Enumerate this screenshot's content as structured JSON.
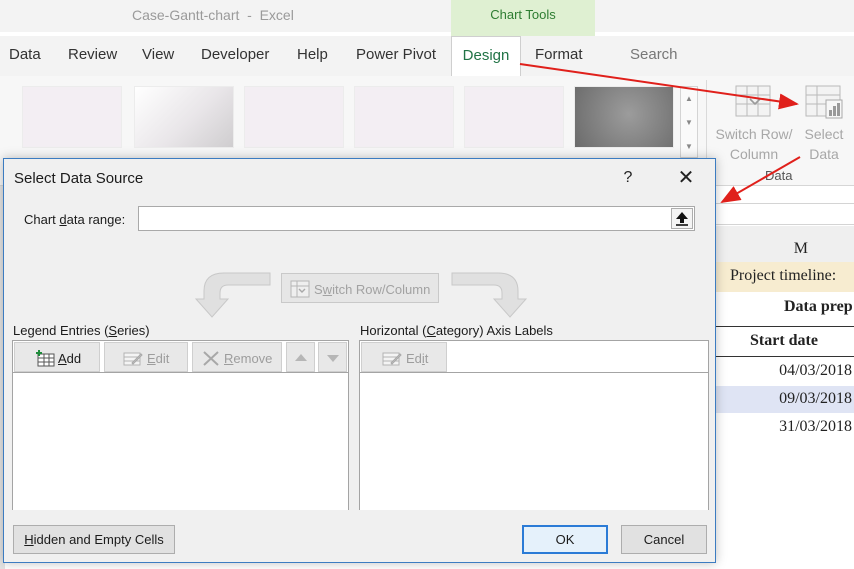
{
  "excel": {
    "doc_title": "Case-Gantt-chart  -  Excel",
    "context_tab_group": "Chart Tools",
    "tabs": [
      "Data",
      "Review",
      "View",
      "Developer",
      "Help",
      "Power Pivot",
      "Design",
      "Format"
    ],
    "search_label": "Search",
    "ribbon": {
      "switch_row_column": [
        "Switch Row/",
        "Column"
      ],
      "select_data": [
        "Select",
        "Data"
      ],
      "group_label": "Data"
    },
    "sheet": {
      "column_header": "M",
      "project_timeline": "Project timeline:",
      "data_prep": "Data prep",
      "start_date_header": "Start date",
      "dates": [
        "04/03/2018",
        "09/03/2018",
        "31/03/2018"
      ]
    }
  },
  "dialog": {
    "title": "Select Data Source",
    "help": "?",
    "close": "✕",
    "chart_range": {
      "label_pre": "Chart ",
      "label_u": "d",
      "label_post": "ata range:",
      "value": ""
    },
    "switch_button": {
      "pre": "S",
      "u": "w",
      "post": "itch Row/Column"
    },
    "series_section": {
      "pre": "Legend Entries (",
      "u": "S",
      "post": "eries)"
    },
    "axis_section": {
      "pre": "Horizontal (",
      "u": "C",
      "post": "ategory) Axis Labels"
    },
    "series_toolbar": {
      "add": {
        "u": "A",
        "post": "dd"
      },
      "edit": {
        "u": "E",
        "post": "dit"
      },
      "remove": {
        "u": "R",
        "post": "emove"
      }
    },
    "axis_toolbar": {
      "edit": {
        "pre": "Ed",
        "u": "i",
        "post": "t"
      }
    },
    "buttons": {
      "hidden_cells": {
        "u": "H",
        "post": "idden and Empty Cells"
      },
      "ok": "OK",
      "cancel": "Cancel"
    }
  },
  "colors": {
    "accent": "#217346",
    "dialog_border": "#3c7cc1",
    "annotation_arrow": "#e0201b",
    "timeline_fill": "#f7ecd0",
    "selected_row": "#dfe4f4"
  }
}
